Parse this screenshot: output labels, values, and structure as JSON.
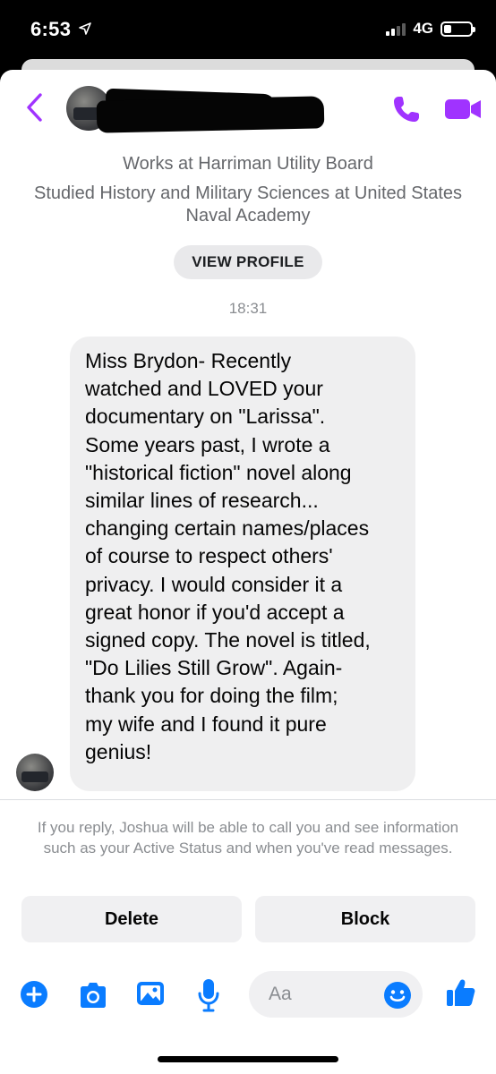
{
  "status_bar": {
    "time": "6:53",
    "network": "4G",
    "battery_level": 0.3
  },
  "header": {
    "back_icon": "chevron-left-icon",
    "phone_icon": "phone-icon",
    "video_icon": "video-camera-icon",
    "accent_color": "#a033ff"
  },
  "profile": {
    "work": "Works at Harriman Utility Board",
    "education": "Studied History and Military Sciences at United States Naval Academy",
    "view_profile_label": "VIEW PROFILE"
  },
  "conversation": {
    "timestamp": "18:31",
    "message": "Miss Brydon- Recently\nwatched and LOVED your\ndocumentary on \"Larissa\".\nSome years past, I wrote a\n\"historical fiction\" novel along\nsimilar lines of research...\nchanging certain names/places\nof course to respect others'\nprivacy. I would consider it a\ngreat honor if you'd accept a\nsigned copy. The novel is titled,\n\"Do Lilies Still Grow\". Again-\nthank you for doing the film;\nmy wife and I found it pure\ngenius!"
  },
  "request_notice": "If you reply, Joshua will be able to call you and see information such as your Active Status and when you've read messages.",
  "actions": {
    "delete_label": "Delete",
    "block_label": "Block"
  },
  "composer": {
    "placeholder": "Aa",
    "icons": [
      "plus-icon",
      "camera-icon",
      "photo-icon",
      "microphone-icon",
      "emoji-icon",
      "thumbs-up-icon"
    ],
    "icon_color": "#0a7cff"
  }
}
